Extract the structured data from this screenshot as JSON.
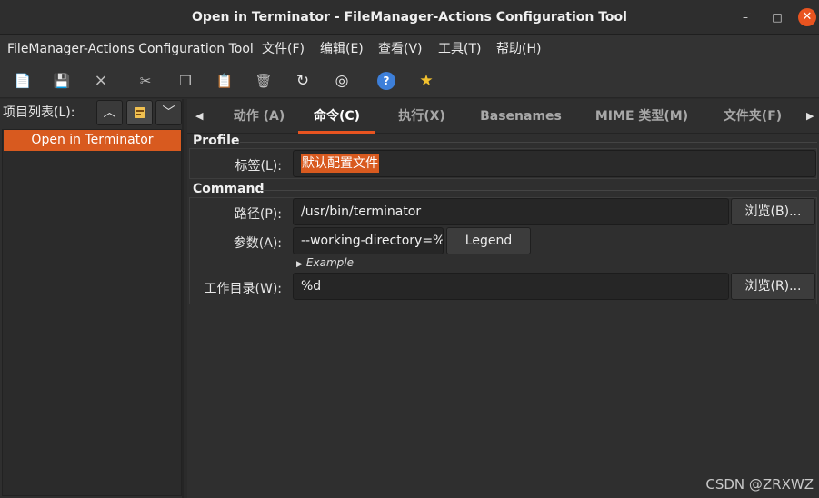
{
  "window": {
    "title": "Open in Terminator - FileManager-Actions Configuration Tool",
    "min_glyph": "–",
    "max_glyph": "□",
    "close_glyph": "✕"
  },
  "menubar": {
    "items": [
      "FileManager-Actions Configuration Tool",
      "文件(F)",
      "编辑(E)",
      "查看(V)",
      "工具(T)",
      "帮助(H)"
    ]
  },
  "toolbar": {
    "icons": [
      "new-item-icon",
      "save-icon",
      "close-icon",
      "cut-icon",
      "copy-icon",
      "paste-icon",
      "delete-icon",
      "reload-icon",
      "target-icon",
      "help-icon",
      "star-icon"
    ],
    "glyphs": [
      "📄",
      "💾",
      "×",
      "✂",
      "❐",
      "📋",
      "🗑",
      "↻",
      "◎",
      "?",
      "★"
    ]
  },
  "left": {
    "list_label": "项目列表(L):",
    "up_glyph": "︿",
    "down_glyph": "﹀",
    "items": [
      "Open in Terminator"
    ]
  },
  "tabs": {
    "left_arrow": "◀",
    "right_arrow": "▶",
    "items": [
      "动作 (A)",
      "命令(C)",
      "执行(X)",
      "Basenames",
      "MIME 类型(M)",
      "文件夹(F)"
    ],
    "active_index": 1
  },
  "profile": {
    "section": "Profile",
    "label_caption": "标签(L):",
    "label_value": "默认配置文件"
  },
  "command": {
    "section": "Command",
    "path_caption": "路径(P):",
    "path_value": "/usr/bin/terminator",
    "browse_path": "浏览(B)...",
    "params_caption": "参数(A):",
    "params_value": "--working-directory=%",
    "legend_button": "Legend",
    "example_expander": "Example",
    "workdir_caption": "工作目录(W):",
    "workdir_value": "%d",
    "browse_workdir": "浏览(R)..."
  },
  "watermark": "CSDN @ZRXWZ"
}
